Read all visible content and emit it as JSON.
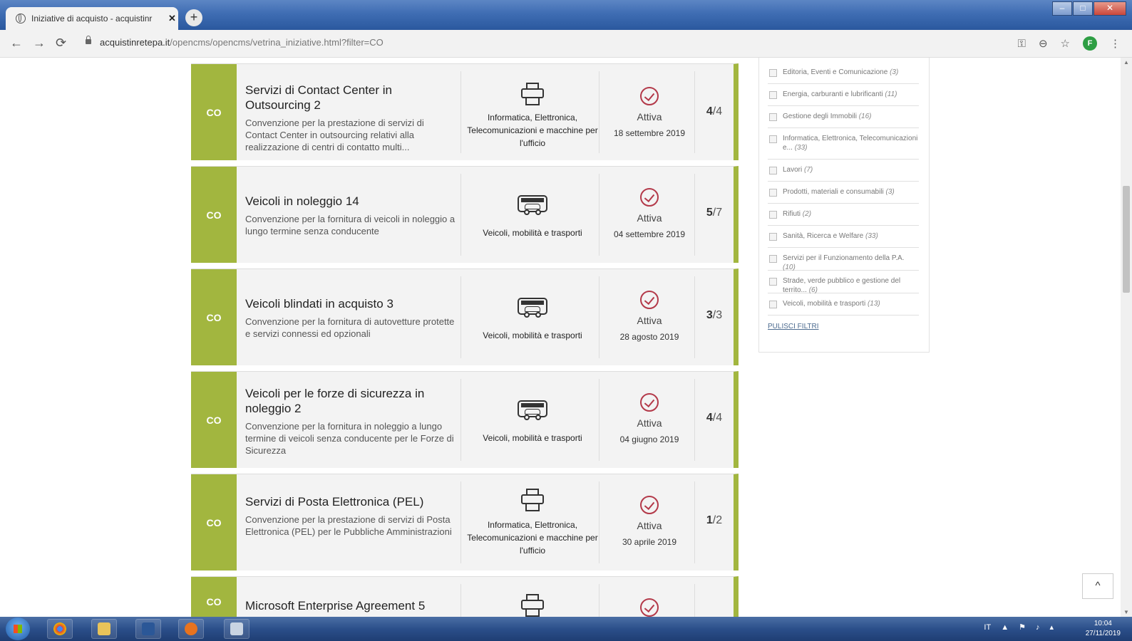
{
  "browser": {
    "tab_title": "Iniziative di acquisto - acquistinr",
    "new_tab_label": "+",
    "close_tab_label": "✕",
    "url_host": "acquistinretepa.it",
    "url_path": "/opencms/opencms/vetrina_iniziative.html?filter=CO",
    "profile_initial": "F"
  },
  "cards": [
    {
      "badge": "CO",
      "title": "Servizi di Contact Center in Outsourcing 2",
      "description": "Convenzione per la prestazione di servizi di Contact Center in outsourcing relativi alla realizzazione di centri di contatto multi...",
      "category_icon": "printer-icon",
      "category": "Informatica, Elettronica, Telecomunicazioni e macchine per l'ufficio",
      "status": "Attiva",
      "date": "18 settembre 2019",
      "lots_active": "4",
      "lots_total": "/4"
    },
    {
      "badge": "CO",
      "title": "Veicoli in noleggio 14",
      "description": "Convenzione per la fornitura di veicoli in noleggio a lungo termine senza conducente",
      "category_icon": "bus-icon",
      "category": "Veicoli, mobilità e trasporti",
      "status": "Attiva",
      "date": "04 settembre 2019",
      "lots_active": "5",
      "lots_total": "/7"
    },
    {
      "badge": "CO",
      "title": "Veicoli blindati in acquisto 3",
      "description": "Convenzione per la fornitura di autovetture protette e servizi connessi ed opzionali",
      "category_icon": "bus-icon",
      "category": "Veicoli, mobilità e trasporti",
      "status": "Attiva",
      "date": "28 agosto 2019",
      "lots_active": "3",
      "lots_total": "/3"
    },
    {
      "badge": "CO",
      "title": "Veicoli per le forze di sicurezza in noleggio 2",
      "description": "Convenzione per la fornitura in noleggio a lungo termine di veicoli senza conducente per le Forze di Sicurezza",
      "category_icon": "bus-icon",
      "category": "Veicoli, mobilità e trasporti",
      "status": "Attiva",
      "date": "04 giugno 2019",
      "lots_active": "4",
      "lots_total": "/4"
    },
    {
      "badge": "CO",
      "title": "Servizi di Posta Elettronica (PEL)",
      "description": "Convenzione per la prestazione di servizi di Posta Elettronica (PEL) per le Pubbliche Amministrazioni",
      "category_icon": "printer-icon",
      "category": "Informatica, Elettronica, Telecomunicazioni e macchine per l'ufficio",
      "status": "Attiva",
      "date": "30 aprile 2019",
      "lots_active": "1",
      "lots_total": "/2"
    },
    {
      "badge": "CO",
      "title": "Microsoft Enterprise Agreement 5",
      "description": "",
      "category_icon": "printer-icon",
      "category": "",
      "status": "",
      "date": "",
      "lots_active": "",
      "lots_total": ""
    }
  ],
  "filters": {
    "items": [
      {
        "label": "Editoria, Eventi e Comunicazione",
        "count": "(3)"
      },
      {
        "label": "Energia, carburanti e lubrificanti",
        "count": "(11)"
      },
      {
        "label": "Gestione degli Immobili",
        "count": "(16)"
      },
      {
        "label": "Informatica, Elettronica, Telecomunicazioni e...",
        "count": "(33)"
      },
      {
        "label": "Lavori",
        "count": "(7)"
      },
      {
        "label": "Prodotti, materiali e consumabili",
        "count": "(3)"
      },
      {
        "label": "Rifiuti",
        "count": "(2)"
      },
      {
        "label": "Sanità, Ricerca e Welfare",
        "count": "(33)"
      },
      {
        "label": "Servizi per il Funzionamento della P.A.",
        "count": "(10)"
      },
      {
        "label": "Strade, verde pubblico e gestione del territo...",
        "count": "(6)"
      },
      {
        "label": "Veicoli, mobilità e trasporti",
        "count": "(13)"
      }
    ],
    "clear_label": "PULISCI FILTRI"
  },
  "back_to_top": "^",
  "taskbar": {
    "lang": "IT",
    "time": "10:04",
    "date": "27/11/2019"
  }
}
